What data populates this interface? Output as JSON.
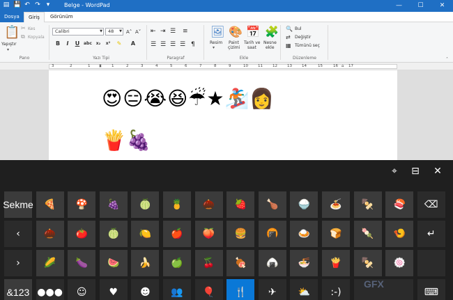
{
  "window": {
    "title": "Belge - WordPad",
    "qat_icons": [
      "wordpad-icon",
      "save-icon",
      "undo-icon",
      "redo-icon",
      "qat-dropdown-icon"
    ],
    "controls": [
      "minimize-icon",
      "maximize-icon",
      "close-icon"
    ]
  },
  "tabs": [
    "Dosya",
    "Giriş",
    "Görünüm"
  ],
  "ribbon": {
    "clipboard": {
      "label": "Pano",
      "paste": "Yapıştır",
      "cut": "Kes",
      "copy": "Kopyala"
    },
    "font": {
      "label": "Yazı Tipi",
      "family": "Calibri",
      "size": "48"
    },
    "paragraph": {
      "label": "Paragraf"
    },
    "insert": {
      "label": "Ekle",
      "picture": "Resim",
      "paint_line1": "Paint",
      "paint_line2": "çizimi",
      "datetime_line1": "Tarih ve",
      "datetime_line2": "saat",
      "object_line1": "Nesne",
      "object_line2": "ekle"
    },
    "editing": {
      "label": "Düzenleme",
      "find": "Bul",
      "replace": "Değiştir",
      "select_all": "Tümünü seç"
    }
  },
  "ruler": {
    "numbers": [
      "3",
      "2",
      "1",
      "1",
      "2",
      "3",
      "4",
      "5",
      "6",
      "7",
      "8",
      "9",
      "10",
      "11",
      "12",
      "13",
      "14",
      "15",
      "16",
      "17"
    ]
  },
  "document": {
    "line1": "😍😑😭😆☔★🏂👩",
    "line2": "🍟🍇"
  },
  "keyboard": {
    "rows": [
      [
        {
          "label": "Sekme",
          "name": "tab-key",
          "type": "text"
        },
        {
          "label": "🍕",
          "name": "pizza-key"
        },
        {
          "label": "🍄",
          "name": "mushroom-key"
        },
        {
          "label": "🍇",
          "name": "grapes-key"
        },
        {
          "label": "🍈",
          "name": "melon-key"
        },
        {
          "label": "🍍",
          "name": "pineapple-key"
        },
        {
          "label": "🌰",
          "name": "chestnut-key"
        },
        {
          "label": "🍓",
          "name": "strawberry-key"
        },
        {
          "label": "🍗",
          "name": "poultry-leg-key"
        },
        {
          "label": "🍚",
          "name": "rice-key"
        },
        {
          "label": "🍝",
          "name": "spaghetti-key"
        },
        {
          "label": "🍢",
          "name": "oden-key"
        },
        {
          "label": "🍣",
          "name": "sushi-key"
        },
        {
          "label": "⌫",
          "name": "backspace-key",
          "type": "dark"
        }
      ],
      [
        {
          "label": "‹",
          "name": "previous-page-key",
          "type": "dark"
        },
        {
          "label": "🌰",
          "name": "chestnut-brown-key"
        },
        {
          "label": "🍅",
          "name": "tomato-key"
        },
        {
          "label": "🍈",
          "name": "honeydew-key"
        },
        {
          "label": "🍋",
          "name": "lemon-key"
        },
        {
          "label": "🍎",
          "name": "red-apple-key"
        },
        {
          "label": "🍑",
          "name": "peach-key"
        },
        {
          "label": "🍔",
          "name": "hamburger-key"
        },
        {
          "label": "🍘",
          "name": "rice-cracker-key"
        },
        {
          "label": "🍛",
          "name": "curry-key"
        },
        {
          "label": "🍞",
          "name": "bread-key"
        },
        {
          "label": "🍡",
          "name": "dango-key"
        },
        {
          "label": "🍤",
          "name": "fried-shrimp-key"
        },
        {
          "label": "↵",
          "name": "enter-key",
          "type": "dark"
        }
      ],
      [
        {
          "label": "›",
          "name": "next-page-key",
          "type": "dark"
        },
        {
          "label": "🌽",
          "name": "corn-key"
        },
        {
          "label": "🍆",
          "name": "eggplant-key"
        },
        {
          "label": "🍉",
          "name": "watermelon-key"
        },
        {
          "label": "🍌",
          "name": "banana-key"
        },
        {
          "label": "🍏",
          "name": "green-apple-key"
        },
        {
          "label": "🍒",
          "name": "cherries-key"
        },
        {
          "label": "🍖",
          "name": "meat-on-bone-key"
        },
        {
          "label": "🍙",
          "name": "rice-ball-key"
        },
        {
          "label": "🍜",
          "name": "noodles-key"
        },
        {
          "label": "🍟",
          "name": "fries-key"
        },
        {
          "label": "🍢",
          "name": "skewer-key"
        },
        {
          "label": "🍥",
          "name": "fish-cake-key"
        },
        {
          "label": "",
          "name": "empty-key",
          "type": "dark"
        }
      ],
      [
        {
          "label": "&123",
          "name": "symbols-key",
          "type": "text"
        },
        {
          "label": "●●●",
          "name": "recent-emoji-key",
          "type": "dark"
        },
        {
          "label": "☺",
          "name": "smiley-category-key",
          "type": "dark"
        },
        {
          "label": "♥",
          "name": "heart-category-key",
          "type": "dark"
        },
        {
          "label": "☻",
          "name": "people-category-key",
          "type": "dark"
        },
        {
          "label": "👥",
          "name": "group-category-key",
          "type": "dark"
        },
        {
          "label": "🎈",
          "name": "celebration-category-key",
          "type": "dark"
        },
        {
          "label": "🍴",
          "name": "food-category-key",
          "type": "active"
        },
        {
          "label": "✈",
          "name": "travel-category-key",
          "type": "dark"
        },
        {
          "label": "⛅",
          "name": "weather-category-key",
          "type": "dark"
        },
        {
          "label": ":-)",
          "name": "emoticon-key",
          "type": "dark"
        },
        {
          "label": "",
          "name": "spacer-key",
          "type": "dark"
        },
        {
          "label": "⌨",
          "name": "keyboard-key",
          "type": "dark"
        }
      ]
    ],
    "watermark": "GFX"
  }
}
